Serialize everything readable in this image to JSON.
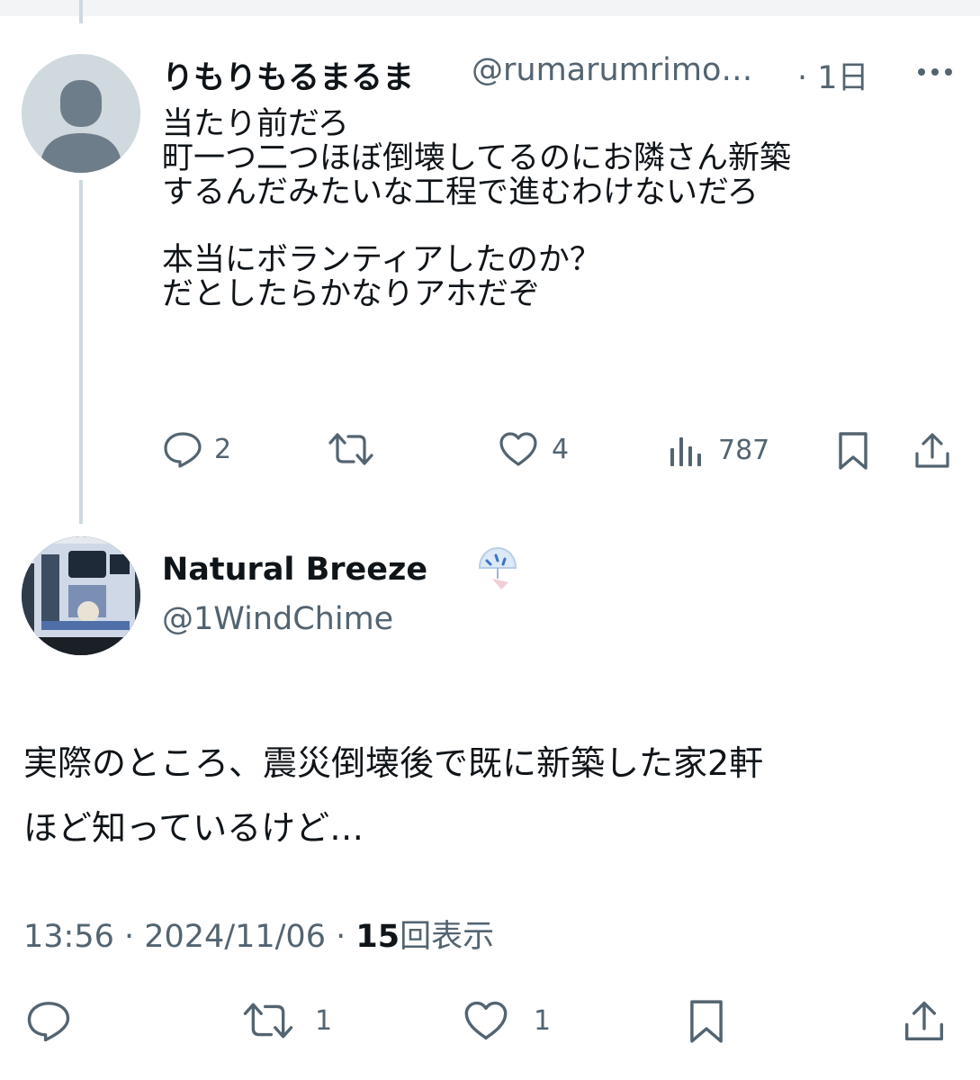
{
  "reply": {
    "display_name": "りもりもるまるま",
    "handle": "@rumarumrimo…",
    "time": "· 1日",
    "text": "当たり前だろ\n町一つ二つほぼ倒壊してるのにお隣さん新築\nするんだみたいな工程で進むわけないだろ\n\n本当にボランティアしたのか？\nだとしたらかなりアホだぞ",
    "replies": "2",
    "likes": "4",
    "views": "787"
  },
  "main": {
    "display_name": "Natural Breeze",
    "handle": "@1WindChime",
    "text": "実際のところ、震災倒壊後で既に新築した家2軒\nほど知っているけど…",
    "time": "13:56 · 2024/11/06 · ",
    "views_count": "15",
    "views_label": "回表示",
    "retweets": "1",
    "likes": "1"
  },
  "colors": {
    "text": "#0f1419",
    "secondary": "#536471",
    "thread_line": "#cfd9de"
  },
  "icons": [
    "more-icon",
    "reply-icon",
    "retweet-icon",
    "like-icon",
    "views-icon",
    "bookmark-icon",
    "share-icon",
    "wind-chime-emoji"
  ]
}
